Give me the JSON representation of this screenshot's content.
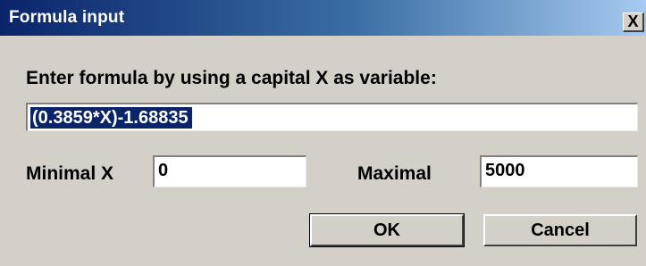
{
  "dialog": {
    "title": "Formula input",
    "close_glyph": "X"
  },
  "form": {
    "prompt": "Enter formula by using a capital X as variable:",
    "formula_value": "(0.3859*X)-1.68835",
    "min_label": "Minimal X",
    "min_value": "0",
    "max_label": "Maximal",
    "max_value": "5000"
  },
  "buttons": {
    "ok_label": "OK",
    "cancel_label": "Cancel"
  },
  "colors": {
    "titlebar_start": "#0a246a",
    "titlebar_end": "#a6caf0",
    "dialog_bg": "#d4d0c8",
    "selection": "#0a246a"
  }
}
